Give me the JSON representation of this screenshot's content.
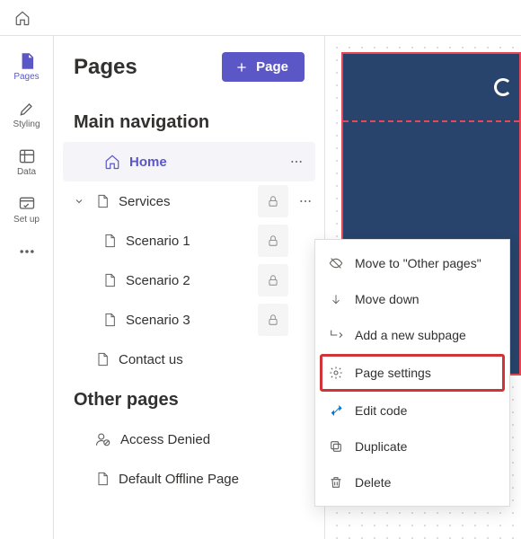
{
  "topbar": {
    "home": "Home"
  },
  "rail": {
    "pages": "Pages",
    "styling": "Styling",
    "data": "Data",
    "setup": "Set up"
  },
  "panel": {
    "title": "Pages",
    "add_button": "Page",
    "section_main": "Main navigation",
    "section_other": "Other pages",
    "items": {
      "home": "Home",
      "services": "Services",
      "scenario1": "Scenario 1",
      "scenario2": "Scenario 2",
      "scenario3": "Scenario 3",
      "contact": "Contact us",
      "access_denied": "Access Denied",
      "default_offline": "Default Offline Page"
    }
  },
  "menu": {
    "move_other": "Move to \"Other pages\"",
    "move_down": "Move down",
    "add_sub": "Add a new subpage",
    "settings": "Page settings",
    "edit_code": "Edit code",
    "duplicate": "Duplicate",
    "delete": "Delete"
  }
}
